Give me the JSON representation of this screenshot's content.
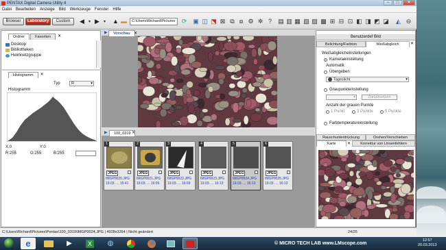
{
  "window": {
    "title": "PENTAX Digital Camera Utility 4",
    "controls": [
      "–",
      "□",
      "✕"
    ]
  },
  "menu": [
    "Datei",
    "Bearbeiten",
    "Anzeige",
    "Bild",
    "Werkzeuge",
    "Fenster",
    "Hilfe"
  ],
  "toolbar": {
    "modes": [
      "Browser",
      "Laboratory",
      "Custom"
    ],
    "active_mode": "Laboratory",
    "path": "C:\\Users\\Richard\\Pictures"
  },
  "left": {
    "tabs": [
      "Ordner",
      "Favoriten"
    ],
    "tree": [
      "Desktop",
      "Bibliotheken",
      "Heimnetzgruppe"
    ],
    "histogram_tab": "Histogramm",
    "typ_label": "Typ",
    "typ_value": "R",
    "histogram_label": "Histogramm",
    "x_label": "X:0",
    "y_label": "Y:0",
    "r_label": "R:255",
    "g_label": "G:255",
    "b_label": "B:255"
  },
  "preview": {
    "tab": "Vorschau"
  },
  "thumbs": {
    "folder_tab": "100_0319",
    "items": [
      {
        "num": "1",
        "jpeg": "JPEG",
        "name": "IMGP0020.JPG",
        "date": "19.03. ... 15:41"
      },
      {
        "num": "2",
        "jpeg": "JPEG",
        "name": "IMGP0021.JPG",
        "date": "19.03. ... 16:06"
      },
      {
        "num": "3",
        "jpeg": "JPEG",
        "name": "IMGP0022.JPG",
        "date": "19.03. ... 16:09"
      },
      {
        "num": "4",
        "jpeg": "JPEG",
        "name": "IMGP0023.JPG",
        "date": "19.03. ... 16:13"
      },
      {
        "num": "5",
        "jpeg": "JPEG",
        "name": "IMGP0024.JPG",
        "date": "19.03. ... 16:13"
      },
      {
        "num": "6",
        "jpeg": "JPEG",
        "name": "IMGP0025.JPG",
        "date": "19.03. ... 16:13"
      }
    ]
  },
  "right": {
    "top_tab": "Benutzerdef Bild",
    "tabs": [
      "Belichtung/Farbton",
      "Weißabgleich"
    ],
    "section": "Weißabgleicheinstellungen",
    "kamera": "Kameraeinstellung",
    "automatik": "Automatik",
    "uebergeben": "Übergeben",
    "tageslicht": "Tageslicht",
    "graupunkt": "Graupunkteinstellung",
    "zuruecksetzen": "Zurücksetzen",
    "anzahl": "Anzahl der grauen Punkte",
    "punkte": [
      "1 Punkt",
      "3 Punkte",
      "5 Punkte"
    ],
    "farbtemp": "Farbtemperatureinstellung",
    "bottom_tabs1": [
      "Rauschunterdrückung",
      "Drehen/Verschieben"
    ],
    "bottom_tabs2": [
      "Karte",
      "Korrektur von Linsenfehlern"
    ]
  },
  "status": {
    "path": "C:\\Users\\Richard\\Pictures\\Pentax\\100_0319\\IMGP0024.JPG | 4928x3264 | Nicht geändert",
    "count": "24/25"
  },
  "taskbar": {
    "watermark": "© MICRO TECH LAB  www.LMscope.com",
    "time": "12:57",
    "date": "20.03.2013"
  }
}
